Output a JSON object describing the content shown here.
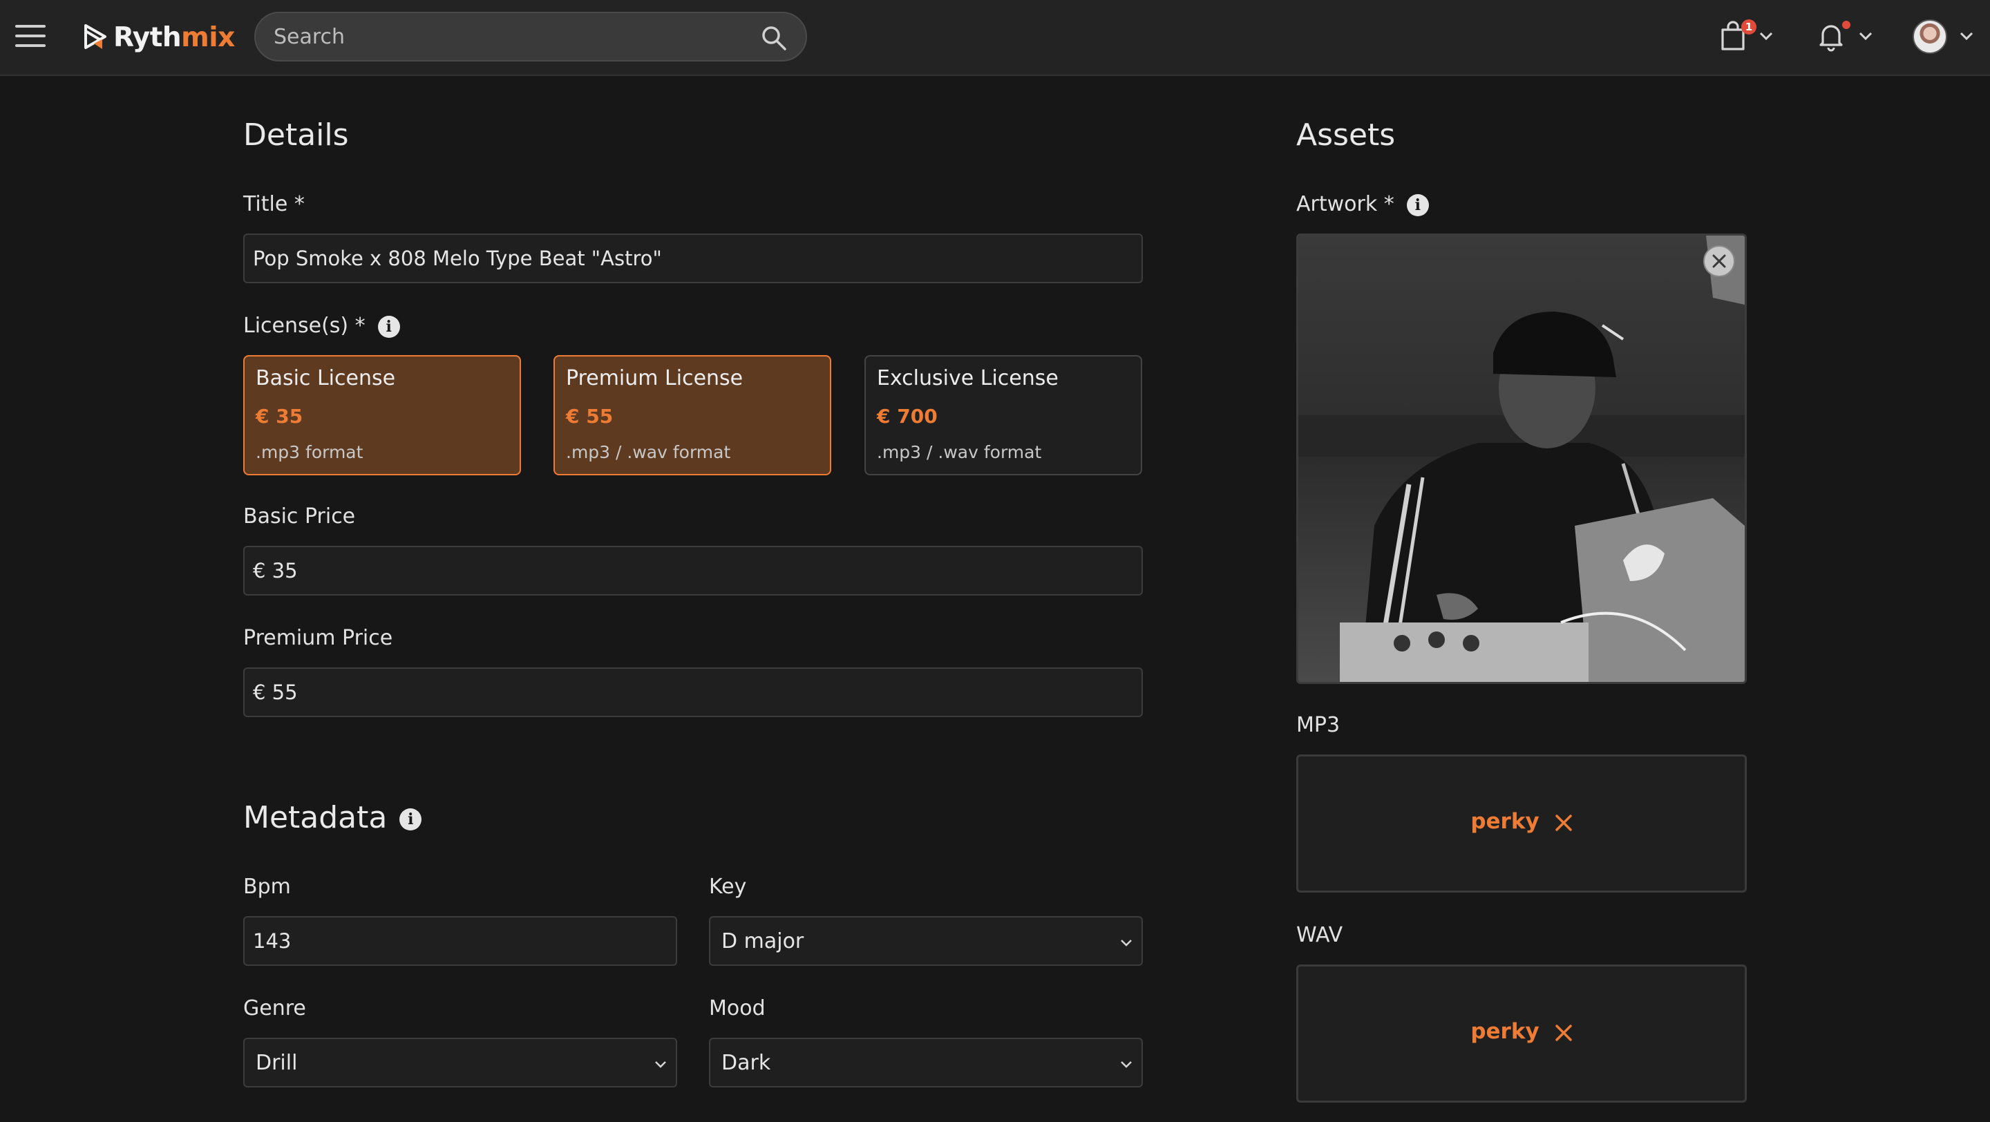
{
  "app": {
    "brand_part1": "Ryth",
    "brand_part2": "mix",
    "accent_color": "#ef7c34"
  },
  "header": {
    "search_placeholder": "Search",
    "cart_badge": "1",
    "icons": [
      "menu-icon",
      "search-icon",
      "shopping-bag-icon",
      "bell-icon",
      "chevron-down-icon"
    ]
  },
  "details": {
    "heading": "Details",
    "title_label": "Title *",
    "title_value": "Pop Smoke x 808 Melo Type Beat \"Astro\"",
    "licenses_label": "License(s) *",
    "licenses": [
      {
        "name": "Basic License",
        "price": "€ 35",
        "format": ".mp3 format",
        "selected": true
      },
      {
        "name": "Premium License",
        "price": "€ 55",
        "format": ".mp3 / .wav format",
        "selected": true
      },
      {
        "name": "Exclusive License",
        "price": "€ 700",
        "format": ".mp3 / .wav format",
        "selected": false
      }
    ],
    "basic_price_label": "Basic Price",
    "basic_price_value": "€ 35",
    "premium_price_label": "Premium Price",
    "premium_price_value": "€ 55"
  },
  "metadata": {
    "heading": "Metadata",
    "bpm_label": "Bpm",
    "bpm_value": "143",
    "key_label": "Key",
    "key_value": "D major",
    "genre_label": "Genre",
    "genre_value": "Drill",
    "mood_label": "Mood",
    "mood_value": "Dark"
  },
  "assets": {
    "heading": "Assets",
    "artwork_label": "Artwork *",
    "mp3_label": "MP3",
    "mp3_file": "perky",
    "wav_label": "WAV",
    "wav_file": "perky"
  }
}
